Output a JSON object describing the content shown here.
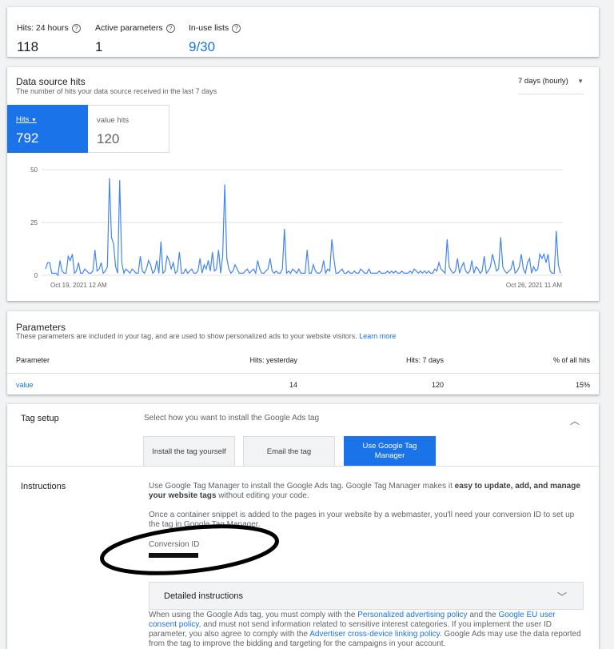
{
  "stats": [
    {
      "label": "Hits: 24 hours",
      "value": "118",
      "help": "?"
    },
    {
      "label": "Active parameters",
      "value": "1",
      "help": "?"
    },
    {
      "label": "In-use lists",
      "value": "9/30",
      "help": "?"
    }
  ],
  "datasource": {
    "title": "Data source hits",
    "subtitle": "The number of hits your data source received in the last 7 days",
    "range": "7 days (hourly)",
    "tabs": [
      {
        "label": "Hits",
        "value": "792"
      },
      {
        "label": "value hits",
        "value": "120"
      }
    ]
  },
  "chart_data": {
    "type": "line",
    "x_start_label": "Oct 19, 2021 12 AM",
    "x_end_label": "Oct 26, 2021 11 AM",
    "y_ticks": [
      0,
      25,
      50
    ],
    "ylim": [
      0,
      50
    ],
    "grid": true,
    "series": [
      {
        "color": "#4285f4",
        "values": [
          3,
          6,
          6,
          1,
          1,
          1,
          0,
          7,
          2,
          1,
          1,
          9,
          7,
          10,
          1,
          2,
          6,
          1,
          1,
          3,
          2,
          1,
          1,
          2,
          12,
          2,
          3,
          6,
          1,
          2,
          4,
          46,
          18,
          15,
          4,
          1,
          45,
          6,
          1,
          3,
          2,
          1,
          3,
          2,
          1,
          1,
          9,
          2,
          1,
          3,
          7,
          5,
          1,
          2,
          7,
          1,
          16,
          1,
          2,
          9,
          7,
          3,
          6,
          1,
          2,
          11,
          1,
          1,
          3,
          1,
          2,
          3,
          1,
          1,
          2,
          8,
          1,
          5,
          3,
          7,
          2,
          11,
          2,
          3,
          12,
          1,
          9,
          43,
          8,
          3,
          1,
          2,
          5,
          3,
          1,
          1,
          1,
          2,
          3,
          1,
          2,
          3,
          1,
          7,
          3,
          1,
          1,
          2,
          3,
          8,
          2,
          1,
          2,
          1,
          1,
          3,
          22,
          1,
          2,
          1,
          3,
          2,
          1,
          3,
          1,
          1,
          1,
          12,
          1,
          1,
          5,
          2,
          1,
          1,
          2,
          7,
          1,
          3,
          2,
          17,
          8,
          1,
          1,
          2,
          3,
          1,
          1,
          2,
          1,
          1,
          2,
          1,
          1,
          3,
          2,
          1,
          1,
          3,
          1,
          1,
          1,
          1,
          2,
          1,
          1,
          1,
          2,
          1,
          2,
          1,
          2,
          1,
          1,
          2,
          1,
          1,
          1,
          2,
          1,
          3,
          2,
          1,
          2,
          1,
          2,
          1,
          2,
          1,
          1,
          3,
          2,
          6,
          3,
          2,
          1,
          17,
          4,
          2,
          1,
          2,
          8,
          1,
          4,
          6,
          2,
          1,
          2,
          7,
          1,
          4,
          3,
          1,
          2,
          9,
          1,
          2,
          4,
          10,
          6,
          2,
          3,
          18,
          4,
          2,
          1,
          2,
          3,
          7,
          1,
          2,
          4,
          10,
          3,
          1,
          6,
          8,
          1,
          4,
          2,
          3,
          10,
          8,
          10,
          6,
          10,
          2,
          1,
          1,
          21,
          5,
          1
        ]
      }
    ]
  },
  "parameters": {
    "title": "Parameters",
    "description": "These parameters are included in your tag, and are used to show personalized ads to your website visitors.",
    "learn_more": "Learn more",
    "columns": [
      "Parameter",
      "Hits: yesterday",
      "Hits: 7 days",
      "% of all hits"
    ],
    "rows": [
      [
        "value",
        "14",
        "120",
        "15%"
      ]
    ]
  },
  "tagsetup": {
    "label": "Tag setup",
    "prompt": "Select how you want to install the Google Ads tag",
    "options": [
      "Install the tag yourself",
      "Email the tag",
      "Use Google Tag Manager"
    ],
    "instructions_label": "Instructions",
    "p1_a": "Use Google Tag Manager to install the Google Ads tag. Google Tag Manager makes it ",
    "p1_b": "easy to update, add, and manage your website tags",
    "p1_c": " without editing your code.",
    "p2": "Once a container snippet is added to the pages in your website by a webmaster, you'll need your conversion ID to set up the tag in Google Tag Manager.",
    "conversion_label": "Conversion ID",
    "detailed": "Detailed instructions",
    "policy_1": "When using the Google Ads tag, you must comply with the ",
    "policy_link1": "Personalized advertising policy",
    "policy_2": " and the ",
    "policy_link2": "Google EU user consent policy",
    "policy_3": ", and must not send information related to sensitive interest categories. If you implement the user ID parameter, you also agree to comply with the ",
    "policy_link3": "Advertiser cross-device linking policy",
    "policy_4": ". Google Ads may use the data reported from the tag to improve the bidding and targeting for the campaigns in your account."
  },
  "colors": {
    "accent": "#1a73e8",
    "line": "#4285f4"
  }
}
